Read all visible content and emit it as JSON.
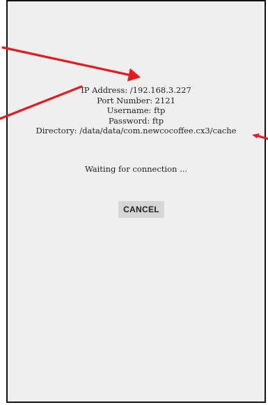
{
  "ftp_info": {
    "ip_address": "IP Address: /192.168.3.227",
    "port_number": "Port Number: 2121",
    "username": "Username: ftp",
    "password": "Password: ftp",
    "directory": "Directory: /data/data/com.newcocoffee.cx3/cache"
  },
  "status_text": "Waiting for connection ...",
  "cancel_label": "CANCEL",
  "colors": {
    "background": "#efefef",
    "button": "#d6d6d6",
    "annotation_arrow": "#e8191a"
  }
}
